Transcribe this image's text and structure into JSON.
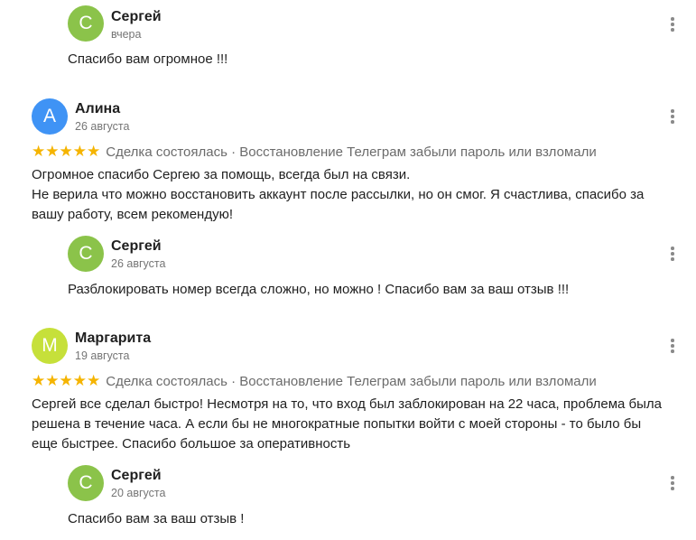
{
  "colors": {
    "avatar_sergey": "#8bc34a",
    "avatar_alina": "#3f93f5",
    "avatar_margarita": "#c6e03a",
    "star": "#f5b400"
  },
  "reply1": {
    "avatar_letter": "С",
    "name": "Сергей",
    "date": "вчера",
    "text": "Спасибо вам огромное !!!"
  },
  "review1": {
    "avatar_letter": "А",
    "name": "Алина",
    "date": "26 августа",
    "rating": 5,
    "stars": [
      "★",
      "★",
      "★",
      "★",
      "★"
    ],
    "tags": "Сделка состоялась · Восстановление Телеграм забыли пароль или взломали",
    "text_lines": [
      "Огромное спасибо Сергею за помощь, всегда был на связи.",
      "Не верила что можно восстановить аккаунт после рассылки, но он смог. Я счастлива, спасибо за",
      "вашу работу, всем рекомендую!"
    ],
    "reply": {
      "avatar_letter": "С",
      "name": "Сергей",
      "date": "26 августа",
      "text": "Разблокировать номер всегда сложно, но можно ! Спасибо вам за ваш отзыв !!!"
    }
  },
  "review2": {
    "avatar_letter": "М",
    "name": "Маргарита",
    "date": "19 августа",
    "rating": 5,
    "stars": [
      "★",
      "★",
      "★",
      "★",
      "★"
    ],
    "tags": "Сделка состоялась · Восстановление Телеграм забыли пароль или взломали",
    "text_lines": [
      "Сергей все сделал быстро! Несмотря на то, что вход был заблокирован на 22 часа, проблема была",
      "решена в течение часа. А если бы не многократные попытки войти с моей стороны - то было бы",
      "еще быстрее. Спасибо большое за оперативность"
    ],
    "reply": {
      "avatar_letter": "С",
      "name": "Сергей",
      "date": "20 августа",
      "text": "Спасибо вам за ваш отзыв !"
    }
  }
}
